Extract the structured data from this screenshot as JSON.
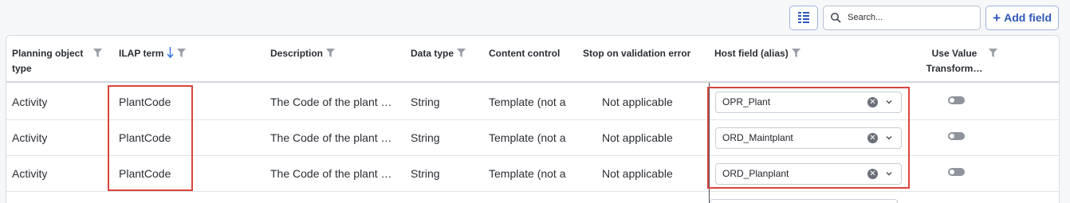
{
  "toolbar": {
    "columns_icon": "column-chooser-icon",
    "search_placeholder": "Search...",
    "search_icon": "search-icon",
    "add_field_label": "Add field",
    "add_icon": "plus-icon"
  },
  "columns": {
    "planning_object_type": "Planning object type",
    "ilap_term": "ILAP term",
    "description": "Description",
    "data_type": "Data type",
    "content_control": "Content control",
    "stop_on_validation_error": "Stop on validation error",
    "host_field": "Host field (alias)",
    "use_value_transform": "Use Value Transform…"
  },
  "rows": [
    {
      "planning_object_type": "Activity",
      "ilap_term": "PlantCode",
      "description": "The Code of the plant …",
      "data_type": "String",
      "content_control": "Template (not a",
      "stop_on_validation_error": "Not applicable",
      "host_field": "OPR_Plant",
      "use_value_transform": false
    },
    {
      "planning_object_type": "Activity",
      "ilap_term": "PlantCode",
      "description": "The Code of the plant …",
      "data_type": "String",
      "content_control": "Template (not a",
      "stop_on_validation_error": "Not applicable",
      "host_field": "ORD_Maintplant",
      "use_value_transform": false
    },
    {
      "planning_object_type": "Activity",
      "ilap_term": "PlantCode",
      "description": "The Code of the plant …",
      "data_type": "String",
      "content_control": "Template (not a",
      "stop_on_validation_error": "Not applicable",
      "host_field": "ORD_Planplant",
      "use_value_transform": false
    }
  ],
  "colors": {
    "accent": "#2f56b8",
    "highlight": "#d9453d",
    "sort_arrow": "#2f6fd6"
  }
}
